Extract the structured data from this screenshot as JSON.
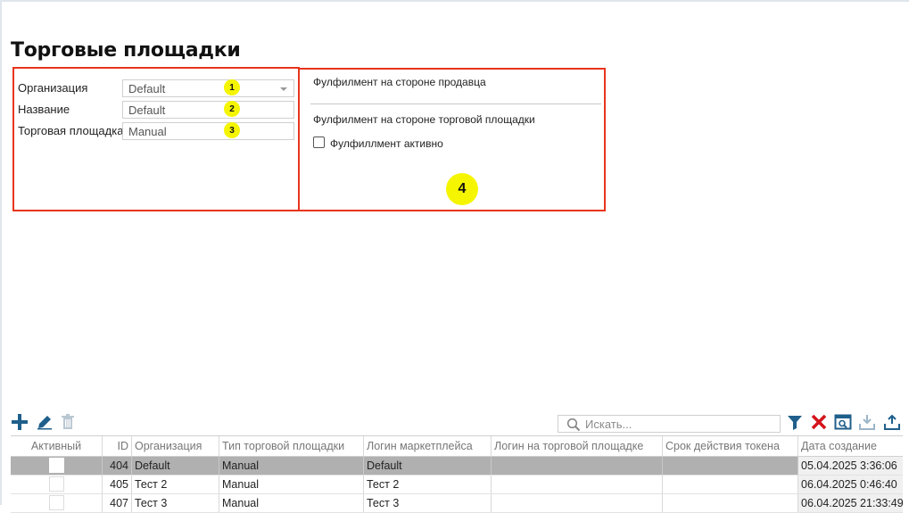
{
  "page": {
    "title": "Торговые площадки"
  },
  "form": {
    "organization_label": "Организация",
    "organization_value": "Default",
    "name_label": "Название",
    "name_value": "Default",
    "marketplace_label": "Торговая площадка",
    "marketplace_value": "Manual"
  },
  "badges": {
    "b1": "1",
    "b2": "2",
    "b3": "3",
    "b4": "4"
  },
  "fulfillment": {
    "seller_side": "Фулфилмент на стороне продавца",
    "marketplace_side": "Фулфилмент на стороне торговой площадки",
    "active_label": "Фулфиллмент активно"
  },
  "toolbar": {
    "icons": [
      "add-icon",
      "edit-icon",
      "delete-icon",
      "filter-icon",
      "clear-filter-icon",
      "preview-icon",
      "download-icon",
      "upload-icon"
    ],
    "search_placeholder": "Искать..."
  },
  "grid": {
    "columns": [
      "Активный",
      "ID",
      "Организация",
      "Тип торговой площадки",
      "Логин маркетплейса",
      "Логин на торговой площадке",
      "Срок действия токена",
      "Дата создание"
    ],
    "rows": [
      {
        "id": "404",
        "org": "Default",
        "type": "Manual",
        "login": "Default",
        "mp_login": "",
        "token": "",
        "created": "05.04.2025 3:36:06"
      },
      {
        "id": "405",
        "org": "Тест 2",
        "type": "Manual",
        "login": "Тест 2",
        "mp_login": "",
        "token": "",
        "created": "06.04.2025 0:46:40"
      },
      {
        "id": "407",
        "org": "Тест 3",
        "type": "Manual",
        "login": "Тест 3",
        "mp_login": "",
        "token": "",
        "created": "06.04.2025 21:33:49"
      }
    ]
  },
  "colors": {
    "highlight_border": "#e8341c",
    "badge": "#f5f500",
    "accent_blue": "#1f5f8b",
    "danger_red": "#d4141c",
    "selected_row": "#b0b0b0"
  }
}
